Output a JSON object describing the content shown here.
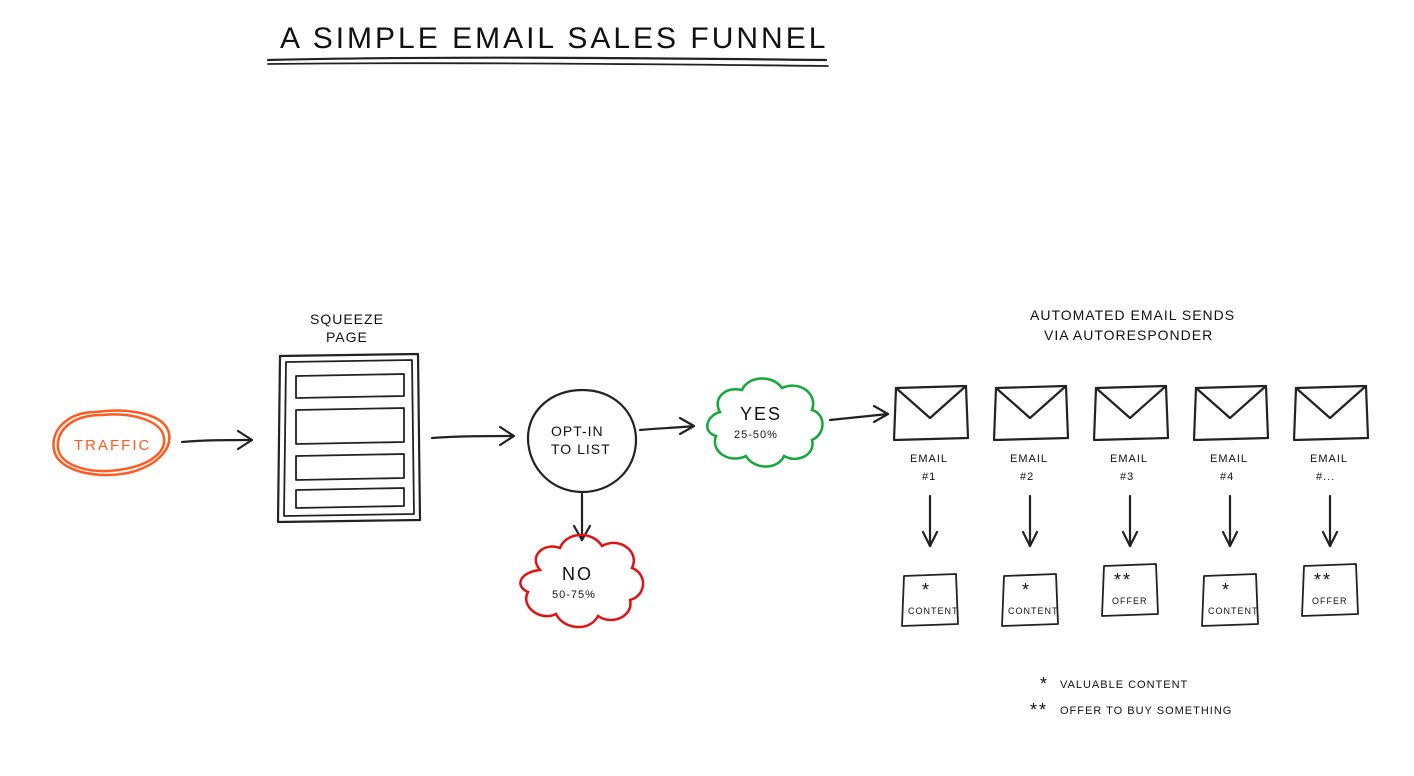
{
  "title": "A SIMPLE EMAIL SALES FUNNEL",
  "traffic": {
    "label": "TRAFFIC"
  },
  "squeeze": {
    "label_line1": "SQUEEZE",
    "label_line2": "PAGE"
  },
  "optin": {
    "label_line1": "OPT-IN",
    "label_line2": "TO LIST"
  },
  "yes": {
    "label": "YES",
    "percent": "25-50%"
  },
  "no": {
    "label": "NO",
    "percent": "50-75%"
  },
  "autoresponder": {
    "label_line1": "AUTOMATED EMAIL SENDS",
    "label_line2": "VIA AUTORESPONDER"
  },
  "emails": [
    {
      "label_line1": "EMAIL",
      "label_line2": "#1",
      "stars": "*",
      "box": "CONTENT"
    },
    {
      "label_line1": "EMAIL",
      "label_line2": "#2",
      "stars": "*",
      "box": "CONTENT"
    },
    {
      "label_line1": "EMAIL",
      "label_line2": "#3",
      "stars": "**",
      "box": "OFFER"
    },
    {
      "label_line1": "EMAIL",
      "label_line2": "#4",
      "stars": "*",
      "box": "CONTENT"
    },
    {
      "label_line1": "EMAIL",
      "label_line2": "#...",
      "stars": "**",
      "box": "OFFER"
    }
  ],
  "legend": {
    "star_single": "*",
    "star_single_label": "VALUABLE CONTENT",
    "star_double": "**",
    "star_double_label": "OFFER TO BUY SOMETHING"
  }
}
